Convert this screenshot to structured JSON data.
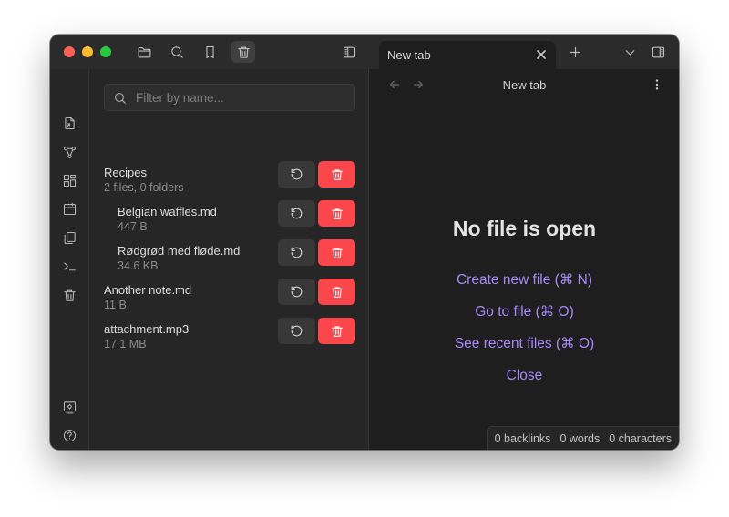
{
  "window": {
    "tab_title": "New tab"
  },
  "titlebar": {
    "icons": [
      "folder-icon",
      "search-icon",
      "bookmark-icon",
      "trash-icon",
      "sidebar-left-icon",
      "plus-icon",
      "chevron-down-icon",
      "sidebar-right-icon"
    ]
  },
  "ribbon": {
    "icons": [
      "open-quick-switcher-icon",
      "graph-icon",
      "canvas-icon",
      "daily-note-icon",
      "templates-icon",
      "command-palette-icon",
      "trash-icon",
      "vault-switcher-icon",
      "help-icon",
      "settings-icon"
    ]
  },
  "sidebar": {
    "search_placeholder": "Filter by name...",
    "items": [
      {
        "name": "Recipes",
        "meta": "2 files, 0 folders",
        "indent": 0
      },
      {
        "name": "Belgian waffles.md",
        "meta": "447 B",
        "indent": 1
      },
      {
        "name": "Rødgrød med fløde.md",
        "meta": "34.6 KB",
        "indent": 1
      },
      {
        "name": "Another note.md",
        "meta": "11 B",
        "indent": 0
      },
      {
        "name": "attachment.mp3",
        "meta": "17.1 MB",
        "indent": 0
      }
    ]
  },
  "main": {
    "view_title": "New tab",
    "empty_title": "No file is open",
    "actions": [
      "Create new file (⌘ N)",
      "Go to file (⌘ O)",
      "See recent files (⌘ O)",
      "Close"
    ]
  },
  "status": {
    "backlinks": "0 backlinks",
    "words": "0 words",
    "characters": "0 characters"
  },
  "colors": {
    "accent": "#a68af9",
    "danger": "#fb464c",
    "background": "#1e1e1e",
    "sidebar": "#262626"
  }
}
